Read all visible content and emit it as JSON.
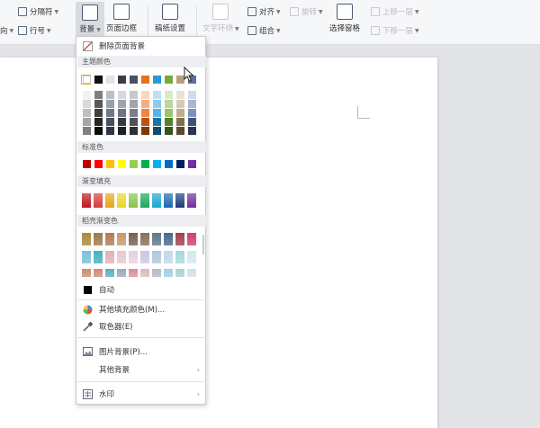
{
  "ribbon": {
    "items": [
      {
        "name": "separator-button",
        "label": "分隔符",
        "icon": "page-break-icon",
        "disabled": false
      },
      {
        "name": "line-number-button",
        "label": "行号",
        "icon": "line-number-icon",
        "disabled": false
      },
      {
        "name": "text-direction-button",
        "label": "向",
        "icon": "text-direction-icon",
        "disabled": false
      }
    ],
    "big": [
      {
        "name": "background-button",
        "label": "背景",
        "icon": "background-icon",
        "disabled": false
      },
      {
        "name": "page-border-button",
        "label": "页面边框",
        "icon": "page-border-icon",
        "disabled": false
      },
      {
        "name": "manuscript-settings-button",
        "label": "稿纸设置",
        "icon": "manuscript-grid-icon",
        "disabled": false
      },
      {
        "name": "text-wrap-button",
        "label": "文字环绕",
        "icon": "text-wrap-icon",
        "disabled": true
      },
      {
        "name": "select-pane-button",
        "label": "选择窗格",
        "icon": "select-pane-icon",
        "disabled": false
      }
    ],
    "align_label": "对齐",
    "group_label": "组合",
    "rotate_label": "旋转",
    "bring_forward_label": "上移一层",
    "send_backward_label": "下移一层"
  },
  "menu": {
    "remove_bg": "删除页面背景",
    "theme_colors": "主题颜色",
    "standard_colors": "标准色",
    "gradient_fill": "渐变填充",
    "texture_gradient": "稻壳渐变色",
    "auto": "自动",
    "other_fill": "其他填充颜色(M)...",
    "eyedropper": "取色器(E)",
    "picture_bg": "图片背景(P)...",
    "other_bg": "其他背景",
    "watermark": "水印"
  },
  "colors": {
    "theme_top": [
      "#ffffff",
      "#000000",
      "#d8dbe0",
      "#404a58",
      "#4472c4",
      "#ed7d31",
      "#a5a5a5",
      "#ffc000",
      "#5b9bd5",
      "#70ad47"
    ],
    "theme_top_display": [
      "#ffffff",
      "#111111",
      "#e1e3e7",
      "#3a3f47",
      "#4a5160",
      "#e8711b",
      "#2a9ad6",
      "#77a83a",
      "#b5a07a",
      "#5a6f9c"
    ],
    "theme_shades": [
      [
        "#f2f2f2",
        "#7f7f7f",
        "#b8c0c8",
        "#d5d8dc",
        "#c6c8cc",
        "#fbd5c0",
        "#bfe0f4",
        "#dbe9cb",
        "#e9e2d5",
        "#d2d9e8"
      ],
      [
        "#d9d9d9",
        "#595959",
        "#94a0ac",
        "#9ea5ad",
        "#a0a4aa",
        "#f7ad85",
        "#8dcaee",
        "#bcd79d",
        "#d6cab3",
        "#aab7d2"
      ],
      [
        "#bfbfbf",
        "#3f3f3f",
        "#6c7a89",
        "#6d7580",
        "#7a7f87",
        "#f38447",
        "#57b2e5",
        "#9ac56b",
        "#c1ae8e",
        "#7e92bb"
      ],
      [
        "#a6a6a6",
        "#262626",
        "#46525f",
        "#363b42",
        "#4e535a",
        "#b85510",
        "#1c72a3",
        "#577f27",
        "#85704d",
        "#3f5177"
      ],
      [
        "#808080",
        "#0d0d0d",
        "#2f3842",
        "#1d2025",
        "#2d3035",
        "#7b380b",
        "#124c6d",
        "#3a551a",
        "#594b33",
        "#2a364f"
      ]
    ],
    "standard": [
      "#c00000",
      "#ff0000",
      "#ffc000",
      "#ffff00",
      "#92d050",
      "#00b050",
      "#00b0f0",
      "#0070c0",
      "#002060",
      "#7030a0"
    ],
    "gradient": [
      "#c0151b",
      "#d83b3b",
      "#e8a51a",
      "#e8d42a",
      "#88c34a",
      "#1aa85a",
      "#19a5d4",
      "#1b66b5",
      "#1f3a7a",
      "#6f2c9b"
    ],
    "texture_row1": [
      "#a88a3a",
      "#9c7a4a",
      "#b07c5a",
      "#c9986a",
      "#7a6050",
      "#8a6e5a",
      "#5a7a8a",
      "#4a6a8a",
      "#a04050",
      "#d04070"
    ],
    "texture_row2": [
      "#7ac0d8",
      "#4cb0c0",
      "#e0b0b8",
      "#e8c8d0",
      "#e8d0e0",
      "#c8c8e8",
      "#b0c8e0",
      "#c0d8e8",
      "#a8d8d8",
      "#d0e8f0"
    ],
    "texture_row3": [
      "#c89070",
      "#d08a80",
      "#5ab0c8",
      "#a0a8b8",
      "#d89098",
      "#e0b8c0",
      "#b8b8c8",
      "#a0d0e0",
      "#b0d0d0",
      "#d0e0e8"
    ],
    "auto": "#000000",
    "accent": "#e8a830"
  }
}
